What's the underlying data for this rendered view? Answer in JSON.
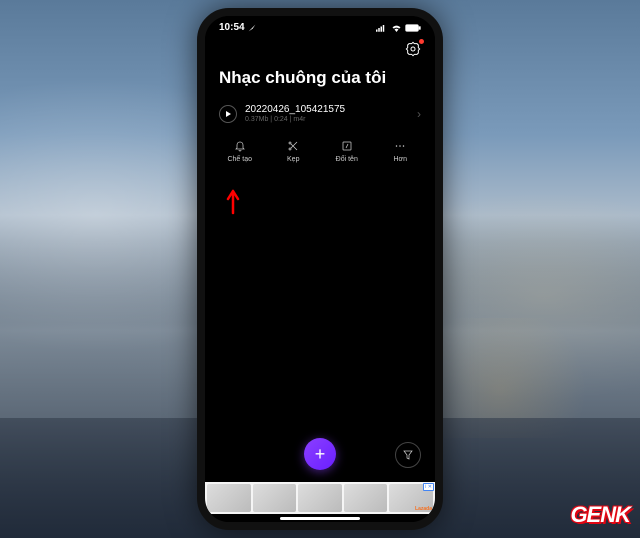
{
  "status_bar": {
    "time": "10:54",
    "location_icon": "location-arrow"
  },
  "header": {
    "title": "Nhạc chuông của tôi"
  },
  "file": {
    "name": "20220426_105421575",
    "size": "0.37Mb",
    "duration": "0:24",
    "format": "m4r"
  },
  "actions": {
    "create": "Chế tạo",
    "clip": "Kẹp",
    "rename": "Đổi tên",
    "more": "Hơn"
  },
  "fab": {
    "label": "+"
  },
  "ad": {
    "badge": "i ✕",
    "brand": "Lazada"
  },
  "watermark": "GENK"
}
